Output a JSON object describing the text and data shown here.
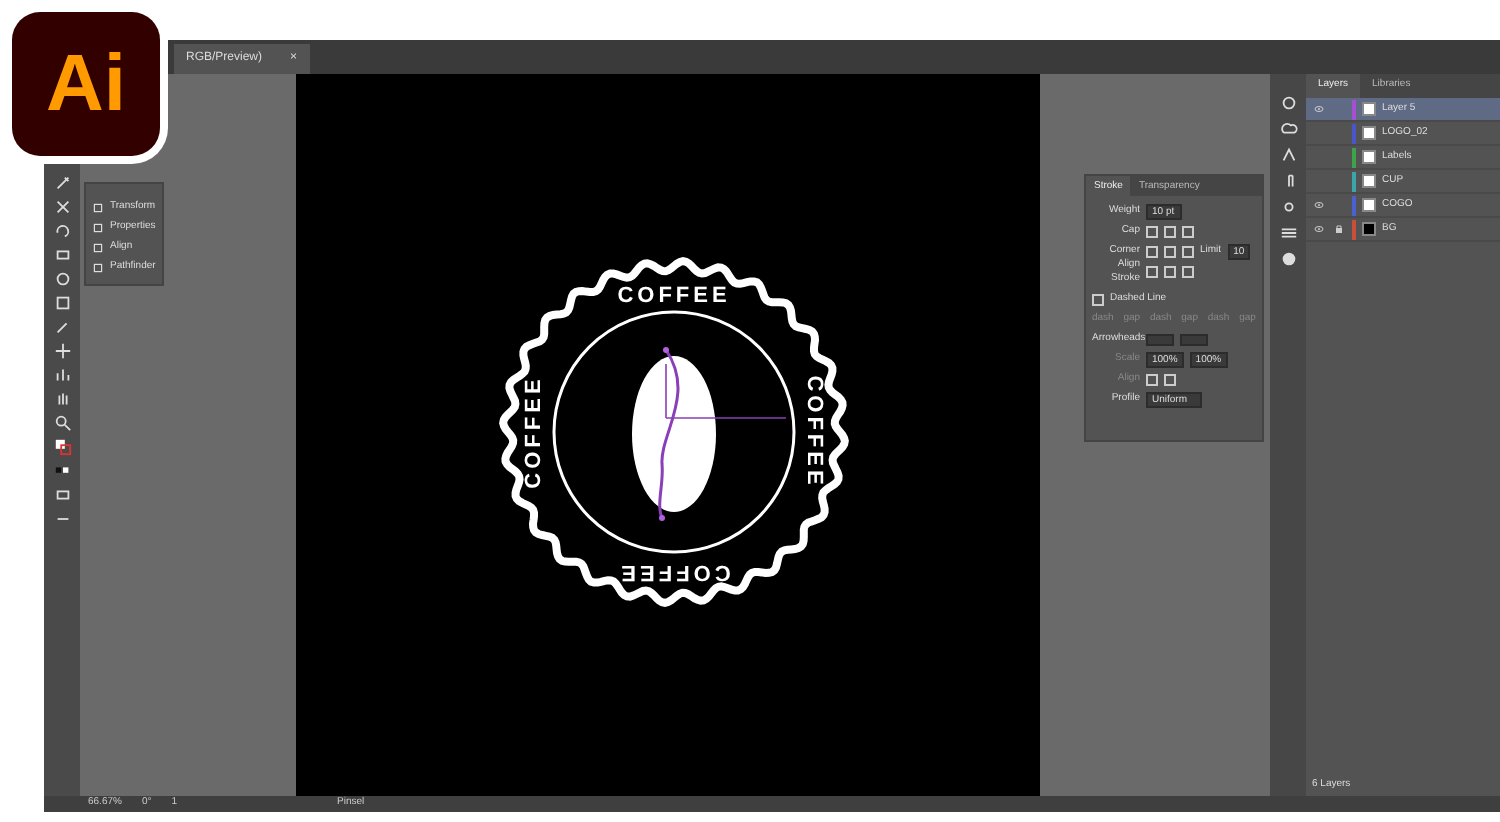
{
  "logo": {
    "text": "Ai"
  },
  "document_tab": {
    "title": "RGB/Preview)",
    "close": "×"
  },
  "tool_panel": {
    "items": [
      "Transform",
      "Properties",
      "Align",
      "Pathfinder"
    ]
  },
  "artboard": {
    "ring_texts": [
      "COFFEE",
      "COFFEE",
      "COFFEE",
      "COFFEE"
    ]
  },
  "stroke_panel": {
    "tabs": [
      {
        "label": "Stroke",
        "selected": true
      },
      {
        "label": "Transparency",
        "selected": false
      }
    ],
    "weight_label": "Weight",
    "weight": "10 pt",
    "cap_label": "Cap",
    "corner_label": "Corner",
    "limit_label": "Limit",
    "limit": "10",
    "align_label": "Align Stroke",
    "dashed": {
      "label": "Dashed Line",
      "checked": false
    },
    "dash_labels": [
      "dash",
      "gap",
      "dash",
      "gap",
      "dash",
      "gap"
    ],
    "arrowheads_label": "Arrowheads",
    "scale_label": "Scale",
    "scale_start": "100%",
    "scale_end": "100%",
    "arrow_align_label": "Align",
    "profile_label": "Profile",
    "profile": "Uniform"
  },
  "layers_panel": {
    "tabs": [
      {
        "label": "Layers",
        "selected": true
      },
      {
        "label": "Libraries",
        "selected": false
      }
    ],
    "layers": [
      {
        "name": "Layer 5",
        "color": "#a64fd0",
        "visible": true,
        "locked": false,
        "selected": true
      },
      {
        "name": "LOGO_02",
        "color": "#4a55c8",
        "visible": false,
        "locked": false,
        "selected": false
      },
      {
        "name": "Labels",
        "color": "#3fa34a",
        "visible": false,
        "locked": false,
        "selected": false
      },
      {
        "name": "CUP",
        "color": "#3aa6a8",
        "visible": false,
        "locked": false,
        "selected": false
      },
      {
        "name": "COGO",
        "color": "#4a62d0",
        "visible": true,
        "locked": false,
        "selected": false
      },
      {
        "name": "BG",
        "color": "#c8503a",
        "visible": true,
        "locked": true,
        "selected": false
      }
    ],
    "footer": "6 Layers"
  },
  "status_bar": {
    "zoom": "66.67%",
    "rotation": "0°",
    "artboard": "1",
    "tool": "Pinsel"
  }
}
